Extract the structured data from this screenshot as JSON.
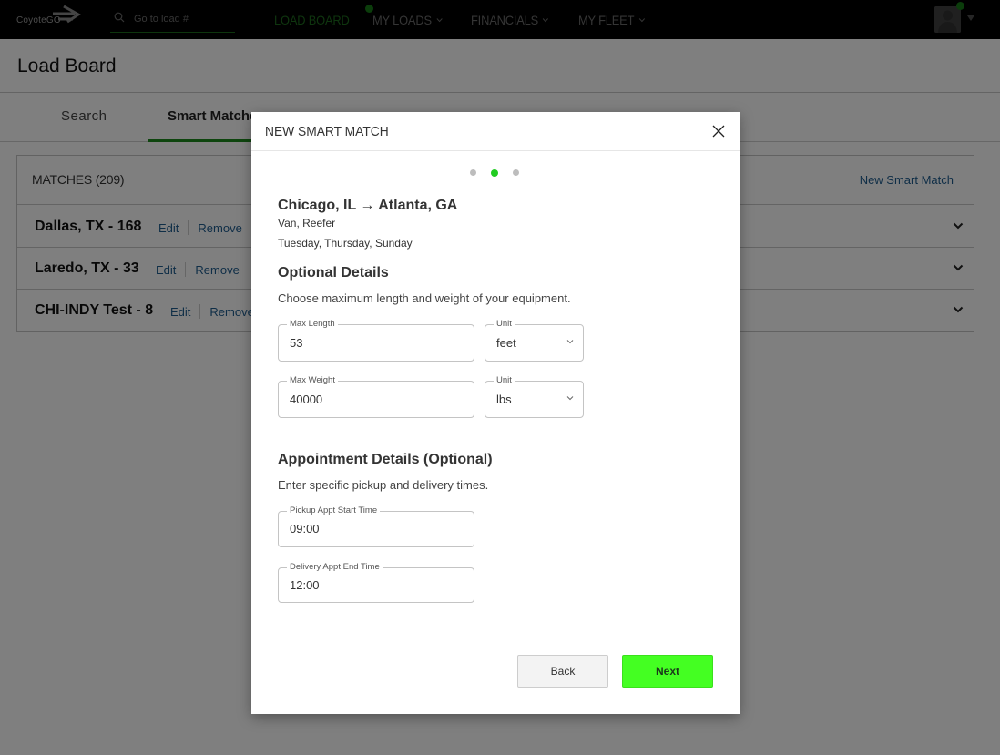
{
  "app": {
    "logo_text": "CoyoteGO"
  },
  "topnav": {
    "search_placeholder": "Go to load #",
    "items": [
      {
        "label": "LOAD BOARD",
        "active": true,
        "has_dropdown": false
      },
      {
        "label": "MY LOADS",
        "active": false,
        "has_dropdown": true
      },
      {
        "label": "FINANCIALS",
        "active": false,
        "has_dropdown": true
      },
      {
        "label": "MY FLEET",
        "active": false,
        "has_dropdown": true
      }
    ],
    "accent_color": "#1d6a1d",
    "notification_dot_color": "#177a17"
  },
  "page": {
    "title": "Load Board",
    "tabs": [
      {
        "label": "Search",
        "active": false
      },
      {
        "label": "Smart Matches",
        "active": true
      }
    ]
  },
  "matches": {
    "title": "MATCHES (209)",
    "new_link": "New Smart Match",
    "rows": [
      {
        "name": "Dallas, TX  - 168",
        "edit": "Edit",
        "remove": "Remove"
      },
      {
        "name": "Laredo, TX  - 33",
        "edit": "Edit",
        "remove": "Remove"
      },
      {
        "name": "CHI-INDY Test  - 8",
        "edit": "Edit",
        "remove": "Remove"
      }
    ]
  },
  "modal": {
    "title": "NEW SMART MATCH",
    "steps": {
      "total": 3,
      "current": 2
    },
    "route": "Chicago, IL  →  Atlanta, GA",
    "equipment": "Van, Reefer",
    "days": "Tuesday, Thursday, Sunday",
    "optional": {
      "title": "Optional Details",
      "description": "Choose maximum length and weight of your equipment.",
      "max_length": {
        "label": "Max Length",
        "value": "53"
      },
      "length_unit": {
        "label": "Unit",
        "value": "feet"
      },
      "max_weight": {
        "label": "Max Weight",
        "value": "40000"
      },
      "weight_unit": {
        "label": "Unit",
        "value": "lbs"
      }
    },
    "appointment": {
      "title": "Appointment Details (Optional)",
      "description": "Enter specific pickup and delivery times.",
      "pickup": {
        "label": "Pickup Appt Start Time",
        "value": "09:00"
      },
      "delivery": {
        "label": "Delivery Appt End Time",
        "value": "12:00"
      }
    },
    "buttons": {
      "back": "Back",
      "next": "Next"
    },
    "next_color": "#44ff22",
    "active_step_color": "#22cc22"
  }
}
